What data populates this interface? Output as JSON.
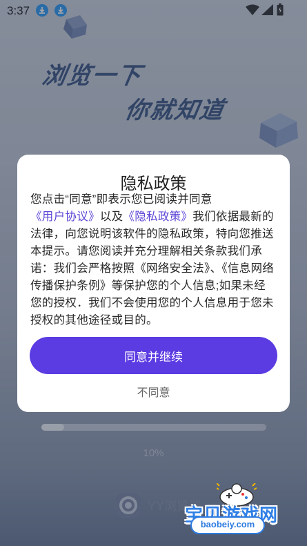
{
  "status_bar": {
    "time": "3:37",
    "icons": [
      "download-icon",
      "download-icon",
      "wifi-icon",
      "signal-icon",
      "battery-icon"
    ]
  },
  "hero": {
    "line1": "浏览一下",
    "line2": "你就知道"
  },
  "loading": {
    "progress_fraction": 0.1,
    "progress_text": "10%"
  },
  "brand": {
    "name": "YY浏览器"
  },
  "watermark": {
    "title": "宝贝游戏网",
    "subtitle": "baobeiy.com"
  },
  "dialog": {
    "title": "隐私政策",
    "body_prefix": "您点击“同意”即表示您已阅读并同意",
    "link_user_agreement": "《用户协议》",
    "body_and": "以及",
    "link_privacy_policy": "《隐私政策》",
    "body_rest": "我们依据最新的法律，向您说明该软件的隐私政策，特向您推送本提示。请您阅读并充分理解相关条款我们承诺：我们会严格按照《网络安全法》、《信息网络传播保护条例》等保护您的个人信息;如果未经您的授权．我们不会使用您的个人信息用于您未授权的其他途径或目的。",
    "agree_label": "同意并继续",
    "disagree_label": "不同意"
  },
  "colors": {
    "accent": "#5b3be2",
    "link": "#5b45d6",
    "download_badge": "#2f9cf3"
  }
}
